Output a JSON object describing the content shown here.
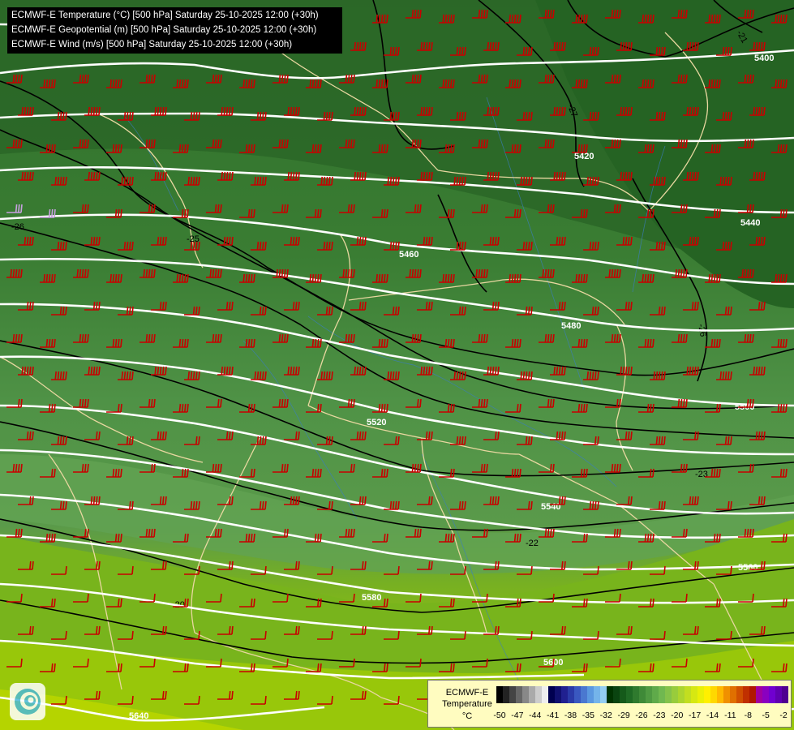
{
  "titles": [
    "ECMWF-E Temperature (°C) [500 hPa] Saturday 25-10-2025 12:00 (+30h)",
    "ECMWF-E Geopotential (m) [500 hPa] Saturday 25-10-2025 12:00 (+30h)",
    "ECMWF-E Wind (m/s) [500 hPa] Saturday 25-10-2025 12:00 (+30h)"
  ],
  "legend": {
    "model": "ECMWF-E",
    "variable": "Temperature",
    "unit": "°C",
    "ticks": [
      "-50",
      "-47",
      "-44",
      "-41",
      "-38",
      "-35",
      "-32",
      "-29",
      "-26",
      "-23",
      "-20",
      "-17",
      "-14",
      "-11",
      "-8",
      "-5",
      "-2"
    ],
    "colors": [
      "#000000",
      "#222222",
      "#444444",
      "#666666",
      "#888888",
      "#aaaaaa",
      "#cccccc",
      "#eeeeee",
      "#000050",
      "#101070",
      "#202090",
      "#2a3aa8",
      "#3a58c0",
      "#4a78d0",
      "#5a98e0",
      "#74b4ea",
      "#94cdf2",
      "#003300",
      "#0a4410",
      "#155a1a",
      "#1f6a24",
      "#2f7a2e",
      "#3f8a38",
      "#4f9a42",
      "#5faa4a",
      "#70b850",
      "#84c24a",
      "#98cc3c",
      "#acd52e",
      "#c2de20",
      "#d6e812",
      "#eaf006",
      "#fff000",
      "#ffd800",
      "#ffb800",
      "#f09000",
      "#e07000",
      "#d05000",
      "#c03000",
      "#b01800",
      "#a000a0",
      "#8a00c0",
      "#7000d0",
      "#6000b0",
      "#500090"
    ]
  },
  "contours": {
    "geopotential": [
      "5400",
      "5420",
      "5440",
      "5460",
      "5480",
      "5500",
      "5520",
      "5540",
      "5560",
      "5580",
      "5600",
      "5620",
      "5640"
    ],
    "temperature": [
      "-21",
      "-27",
      "-26",
      "-26",
      "-25",
      "-23",
      "-22",
      "-20"
    ]
  },
  "colors": {
    "barb": "#c80000",
    "geopotential_line": "#ffffff",
    "temperature_line": "#000000",
    "border": "#e8d7a0",
    "river": "#3a7dc4"
  },
  "icons": {
    "logo": "ecmwf-logo-icon"
  }
}
